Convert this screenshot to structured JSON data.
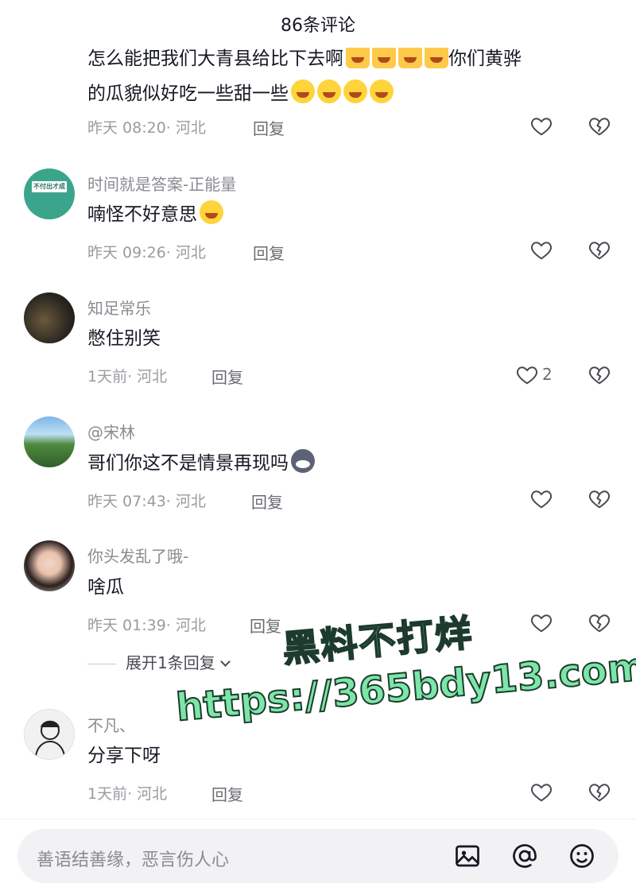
{
  "header": {
    "title": "86条评论"
  },
  "comments": [
    {
      "username": "",
      "lines": [
        {
          "text": "怎么能把我们大青县给比下去啊",
          "emojis": [
            "crown",
            "crown",
            "crown",
            "crown"
          ],
          "after": "你们黄骅"
        },
        {
          "text": "的瓜貌似好吃一些甜一些",
          "emojis": [
            "cry",
            "cry",
            "cry",
            "cry"
          ],
          "after": ""
        }
      ],
      "time": "昨天 08:20",
      "location": "· 河北",
      "reply": "回复",
      "likes": ""
    },
    {
      "username": "时间就是答案-正能量",
      "lines": [
        {
          "text": "喃怪不好意思",
          "emojis": [
            "cry"
          ],
          "after": ""
        }
      ],
      "time": "昨天 09:26",
      "location": "· 河北",
      "reply": "回复",
      "likes": "",
      "avatar_text": "不付出才成功"
    },
    {
      "username": "知足常乐",
      "lines": [
        {
          "text": "憋住别笑",
          "emojis": [],
          "after": ""
        }
      ],
      "time": "1天前",
      "location": "· 河北",
      "reply": "回复",
      "likes": "2"
    },
    {
      "username": "@宋林",
      "lines": [
        {
          "text": "哥们你这不是情景再现吗",
          "emojis": [
            "cat"
          ],
          "after": ""
        }
      ],
      "time": "昨天 07:43",
      "location": "· 河北",
      "reply": "回复",
      "likes": ""
    },
    {
      "username": "你头发乱了哦-",
      "lines": [
        {
          "text": "啥瓜",
          "emojis": [],
          "after": ""
        }
      ],
      "time": "昨天 01:39",
      "location": "· 河北",
      "reply": "回复",
      "likes": ""
    },
    {
      "username": "不凡、",
      "lines": [
        {
          "text": "分享下呀",
          "emojis": [],
          "after": ""
        }
      ],
      "time": "1天前",
      "location": "· 河北",
      "reply": "回复",
      "likes": ""
    }
  ],
  "expand_replies": "展开1条回复",
  "watermark": {
    "line1": "黑料不打烊",
    "line2": "https://365bdy13.com"
  },
  "footer": {
    "placeholder": "善语结善缘，恶言伤人心",
    "icons": [
      "image-icon",
      "at-icon",
      "emoji-icon"
    ]
  },
  "colors": {
    "text": "#161823",
    "meta": "#9a9ba1",
    "input_bg": "#f2f2f4",
    "watermark": "#7be6a8"
  }
}
